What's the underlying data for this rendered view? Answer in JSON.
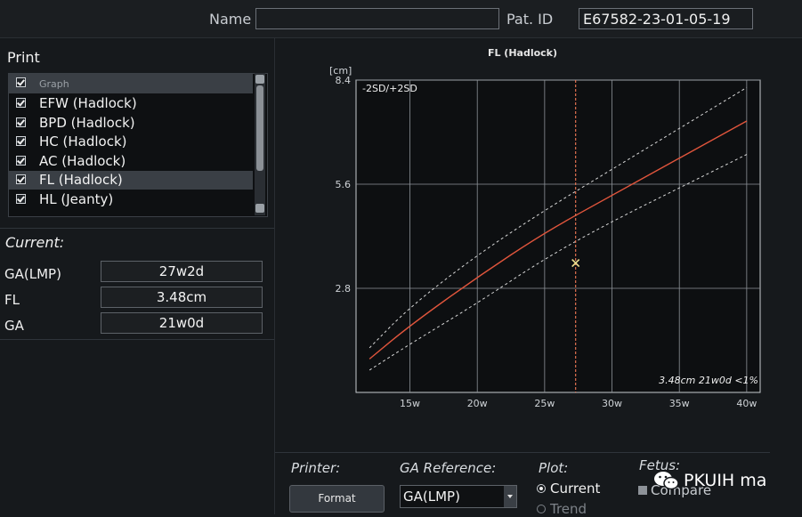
{
  "header": {
    "name_label": "Name",
    "name_value": "",
    "pat_id_label": "Pat. ID",
    "pat_id_value": "E67582-23-01-05-19"
  },
  "print_panel": {
    "title": "Print",
    "list_header": "Graph",
    "items": [
      {
        "label": "EFW (Hadlock)",
        "checked": true,
        "selected": false
      },
      {
        "label": "BPD (Hadlock)",
        "checked": true,
        "selected": false
      },
      {
        "label": "HC (Hadlock)",
        "checked": true,
        "selected": false
      },
      {
        "label": "AC (Hadlock)",
        "checked": true,
        "selected": false
      },
      {
        "label": "FL (Hadlock)",
        "checked": true,
        "selected": true
      },
      {
        "label": "HL (Jeanty)",
        "checked": true,
        "selected": false
      }
    ]
  },
  "current": {
    "title": "Current:",
    "params": [
      {
        "label": "GA(LMP)",
        "value": "27w2d"
      },
      {
        "label": "FL",
        "value": "3.48cm"
      },
      {
        "label": "GA",
        "value": "21w0d"
      }
    ]
  },
  "chart_data": {
    "type": "line",
    "title": "FL (Hadlock)",
    "ylabel": "[cm]",
    "xlabel": "",
    "legend_text": "-2SD/+2SD",
    "annotation": "3.48cm 21w0d <1%",
    "xlim": [
      11,
      41
    ],
    "ylim": [
      0,
      8.4
    ],
    "x_ticks": [
      "15w",
      "20w",
      "25w",
      "30w",
      "35w",
      "40w"
    ],
    "x_tick_values": [
      15,
      20,
      25,
      30,
      35,
      40
    ],
    "y_ticks": [
      "2.8",
      "5.6",
      "8.4"
    ],
    "y_tick_values": [
      2.8,
      5.6,
      8.4
    ],
    "series": [
      {
        "name": "-2SD",
        "style": "dashed",
        "color": "#d8d8d8",
        "x": [
          12,
          15,
          20,
          25,
          30,
          35,
          40
        ],
        "y": [
          0.6,
          1.3,
          2.4,
          3.6,
          4.6,
          5.5,
          6.4
        ]
      },
      {
        "name": "mean",
        "style": "solid",
        "color": "#e0553c",
        "x": [
          12,
          15,
          20,
          25,
          30,
          35,
          40
        ],
        "y": [
          0.9,
          1.8,
          3.1,
          4.3,
          5.3,
          6.3,
          7.3
        ]
      },
      {
        "name": "+2SD",
        "style": "dashed",
        "color": "#d8d8d8",
        "x": [
          12,
          15,
          20,
          25,
          30,
          35,
          40
        ],
        "y": [
          1.2,
          2.3,
          3.7,
          4.9,
          6.0,
          7.1,
          8.2
        ]
      }
    ],
    "current_ga_line": {
      "x": 27.3,
      "color": "#e07050"
    },
    "measurement_point": {
      "x": 27.3,
      "y": 3.48,
      "color": "#f0e090"
    },
    "grid": true
  },
  "bottom": {
    "printer_label": "Printer:",
    "format_button": "Format",
    "ga_reference_label": "GA Reference:",
    "ga_reference_value": "GA(LMP)",
    "plot_label": "Plot:",
    "plot_options": [
      {
        "label": "Current",
        "selected": true
      },
      {
        "label": "Trend",
        "selected": false
      }
    ],
    "fetus_label": "Fetus:",
    "compare_label": "Compare"
  },
  "watermark": "PKUIH ma",
  "colors": {
    "background": "#16191c",
    "mean_curve": "#e0553c",
    "sd_curves": "#d8d8d8",
    "ga_line": "#e07050",
    "point": "#f0e090"
  }
}
